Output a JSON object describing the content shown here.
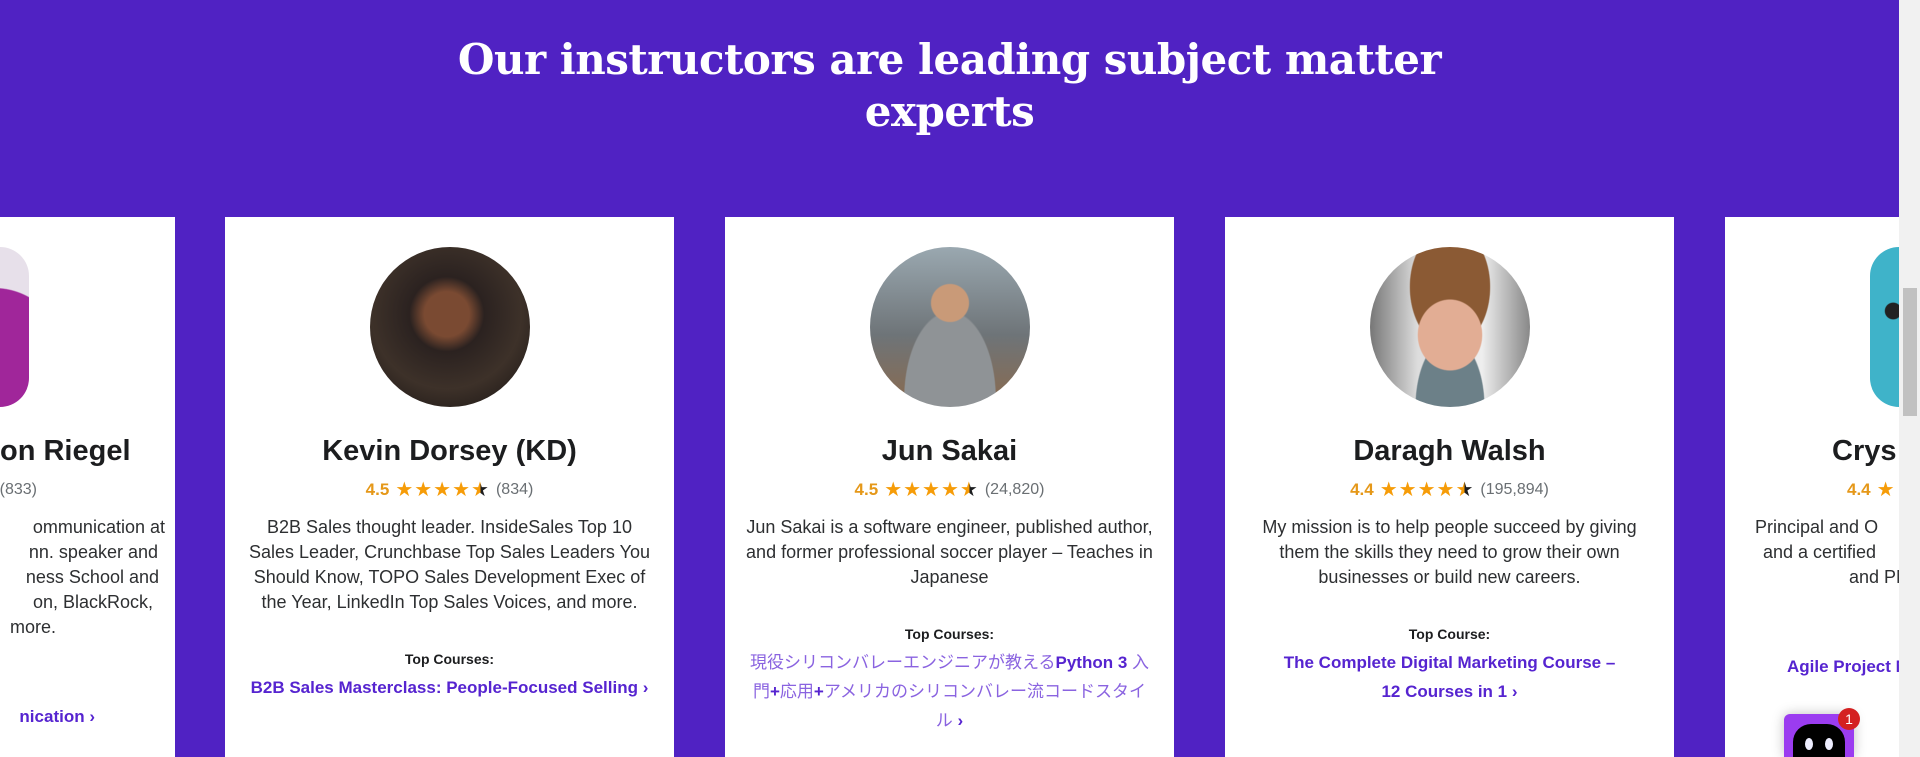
{
  "section_title": [
    "Our instructors are leading subject matter",
    "experts"
  ],
  "colors": {
    "background": "#5022c3",
    "link": "#5624d0",
    "star": "#f69c08"
  },
  "instructors": [
    {
      "name": "on Riegel",
      "rating": "",
      "count": "(833)",
      "desc": [
        "ommunication at",
        "nn. speaker and",
        "ness School and",
        "on, BlackRock,",
        "more."
      ],
      "top_label": "",
      "course": "nication"
    },
    {
      "name": "Kevin Dorsey (KD)",
      "rating": "4.5",
      "count": "(834)",
      "desc": "B2B Sales thought leader. InsideSales Top 10 Sales Leader, Crunchbase Top Sales Leaders You Should Know, TOPO Sales Development Exec of the Year, LinkedIn Top Sales Voices, and more.",
      "top_label": "Top Courses:",
      "course": "B2B Sales Masterclass: People-Focused Selling"
    },
    {
      "name": "Jun Sakai",
      "rating": "4.5",
      "count": "(24,820)",
      "desc": "Jun Sakai is a software engineer, published author, and former professional soccer player – Teaches in Japanese",
      "top_label": "Top Courses:",
      "course_parts": [
        "現役シリコンバレーエンジニアが教える",
        "Python 3",
        "入門",
        "+",
        "応用",
        "+",
        "アメリカのシリコンバレー流コードスタイル"
      ]
    },
    {
      "name": "Daragh Walsh",
      "rating": "4.4",
      "count": "(195,894)",
      "desc": "My mission is to help people succeed by giving them the skills they need to grow their own businesses or build new careers.",
      "top_label": "Top Course:",
      "course": "The Complete Digital Marketing Course – 12 Courses in 1"
    },
    {
      "name": "Crys",
      "rating": "4.4",
      "desc": [
        "Principal and O",
        "and a certified",
        "and PM"
      ],
      "course": "Agile Project M"
    }
  ],
  "chat_widget": {
    "badge_count": "1"
  }
}
